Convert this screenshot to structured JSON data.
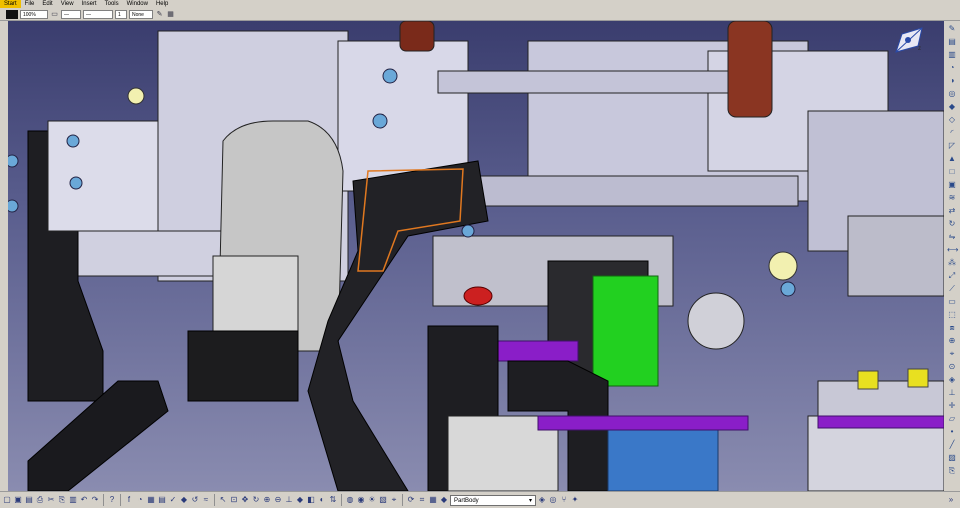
{
  "menu": {
    "items": [
      "Start",
      "File",
      "Edit",
      "View",
      "Insert",
      "Tools",
      "Window",
      "Help"
    ]
  },
  "top_toolbar": {
    "zoom_value": "100%",
    "layer_value": "None",
    "line_number": "1"
  },
  "bottom_toolbar": {
    "part_body_label": "PartBody"
  },
  "colors": {
    "background_top": "#3a3d6e",
    "background_bottom": "#8a8cb0",
    "accent_green": "#22d020",
    "accent_purple": "#8a1ec8",
    "accent_orange": "#e07820"
  },
  "icons": {
    "right": [
      "sketch-icon",
      "pad-icon",
      "pocket-icon",
      "shaft-icon",
      "groove-icon",
      "hole-icon",
      "rib-icon",
      "slot-icon",
      "fillet-icon",
      "chamfer-icon",
      "draft-icon",
      "shell-icon",
      "thickness-icon",
      "thread-icon",
      "translate-icon",
      "rotate-icon",
      "symmetry-icon",
      "mirror-icon",
      "pattern-icon",
      "scale-icon",
      "split-icon",
      "thick-surface-icon",
      "close-surface-icon",
      "sew-surface-icon",
      "boolean-icon",
      "measure-icon",
      "inertia-icon",
      "analysis-icon",
      "constraint-icon",
      "axis-icon",
      "plane-icon",
      "point-icon",
      "line-icon",
      "apply-material-icon",
      "publish-icon",
      "macro-icon",
      "customize-icon",
      "catalog-icon",
      "knowledge-icon",
      "formula-icon",
      "law-icon",
      "table-icon",
      "check-icon",
      "reaction-icon",
      "loop-icon"
    ]
  }
}
